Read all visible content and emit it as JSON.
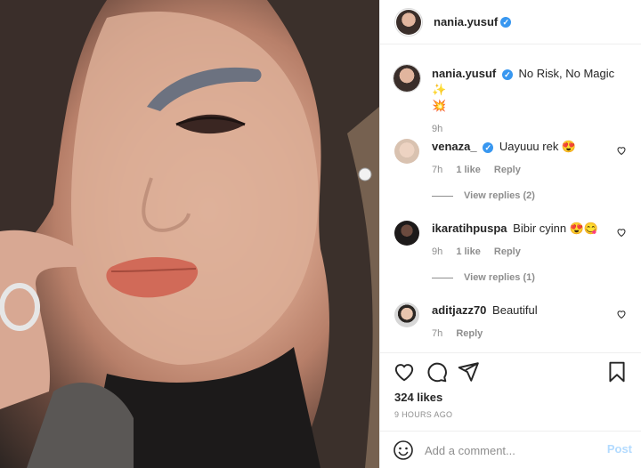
{
  "post": {
    "image_alt": "Close-up selfie photo",
    "author": {
      "username": "nania.yusuf",
      "verified": true
    },
    "caption": {
      "username": "nania.yusuf",
      "text": "No Risk, No Magic",
      "emoji": [
        "✨",
        "💥"
      ],
      "time": "9h"
    },
    "comments": [
      {
        "username": "venaza_",
        "verified": true,
        "text": "Uayuuu rek 😍",
        "time": "7h",
        "likes": "1 like",
        "reply_label": "Reply",
        "view_replies": "View replies (2)"
      },
      {
        "username": "ikaratihpuspa",
        "verified": false,
        "text": "Bibir cyinn 😍😋",
        "time": "9h",
        "likes": "1 like",
        "reply_label": "Reply",
        "view_replies": "View replies (1)"
      },
      {
        "username": "aditjazz70",
        "verified": false,
        "text": "Beautiful",
        "time": "7h",
        "reply_label": "Reply"
      }
    ],
    "likes_count": "324 likes",
    "posted_ago": "9 HOURS AGO",
    "add_comment": {
      "placeholder": "Add a comment...",
      "post_label": "Post"
    }
  },
  "icons": {
    "like": "heart-icon",
    "comment": "comment-icon",
    "share": "share-icon",
    "save": "bookmark-icon",
    "emoji": "emoji-icon"
  },
  "colors": {
    "verified": "#3897f0",
    "muted": "#8e8e8e",
    "post_disabled": "#b3dbff",
    "border": "#efefef"
  }
}
